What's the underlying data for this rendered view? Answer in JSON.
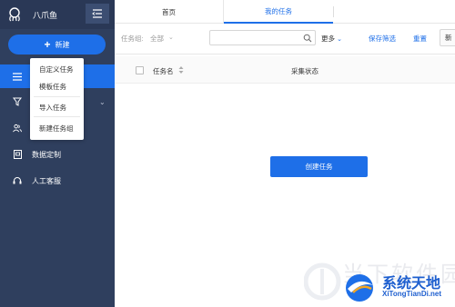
{
  "app": {
    "name": "八爪鱼"
  },
  "sidebar": {
    "new_button_label": "新建",
    "items": [
      {
        "label": "",
        "icon": "menu-icon"
      },
      {
        "label": "",
        "icon": "filter-icon"
      },
      {
        "label": "",
        "icon": "people-icon"
      },
      {
        "label": "数据定制",
        "icon": "data-custom-icon"
      },
      {
        "label": "人工客服",
        "icon": "headset-icon"
      }
    ]
  },
  "dropdown": {
    "items": [
      "自定义任务",
      "模板任务",
      "导入任务",
      "新建任务组"
    ]
  },
  "tabs": [
    {
      "label": "首页",
      "active": false
    },
    {
      "label": "我的任务",
      "active": true
    }
  ],
  "toolbar": {
    "group_label": "任务组:",
    "group_value": "全部",
    "search_placeholder": "",
    "more_label": "更多",
    "save_filter_label": "保存筛选",
    "reset_label": "重置",
    "extra_label": "新"
  },
  "table": {
    "columns": [
      "任务名",
      "采集状态"
    ]
  },
  "main": {
    "create_task_label": "创建任务"
  },
  "watermark": {
    "faint_text": "当下软件园",
    "title": "系统天地",
    "url": "XiTongTianDi.net"
  },
  "colors": {
    "sidebar_bg": "#2f3f5e",
    "accent": "#1e6fe8"
  }
}
